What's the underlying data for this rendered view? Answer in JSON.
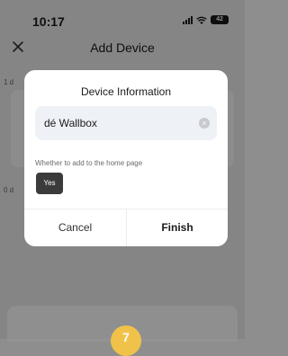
{
  "status_bar": {
    "time": "10:17",
    "battery": "42"
  },
  "nav": {
    "title": "Add Device"
  },
  "background": {
    "label_1": "1 d",
    "label_2": "0 d",
    "step_badge": "7"
  },
  "dialog": {
    "title": "Device Information",
    "device_name_value": "dé Wallbox",
    "home_page_label": "Whether to add to the home page",
    "yes_label": "Yes",
    "cancel_label": "Cancel",
    "finish_label": "Finish"
  },
  "colors": {
    "dialog_bg": "#ffffff",
    "field_bg": "#eef1f6",
    "toggle_bg": "#3b3b3b",
    "badge": "#f0c24a"
  }
}
